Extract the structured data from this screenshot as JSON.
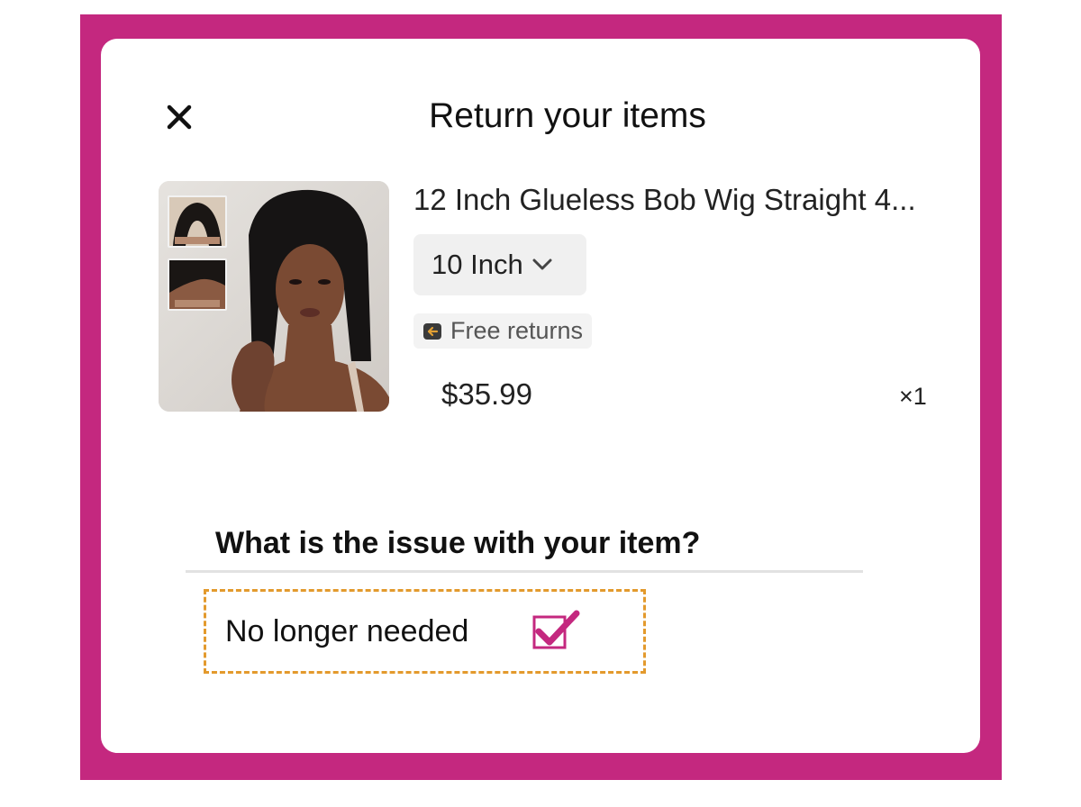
{
  "dialog": {
    "title": "Return your items",
    "close_icon": "close-icon"
  },
  "product": {
    "name": "12 Inch Glueless Bob Wig Straight 4...",
    "variant": "10 Inch",
    "variant_icon": "chevron-down-icon",
    "badge": "Free returns",
    "badge_icon": "return-box-icon",
    "price": "$35.99",
    "quantity": "×1"
  },
  "issue": {
    "question": "What is the issue with your item?",
    "option_label": "No longer needed",
    "option_checked": true
  },
  "colors": {
    "frame": "#c4287f",
    "highlight_border": "#e39a2d",
    "check": "#c4287f"
  }
}
